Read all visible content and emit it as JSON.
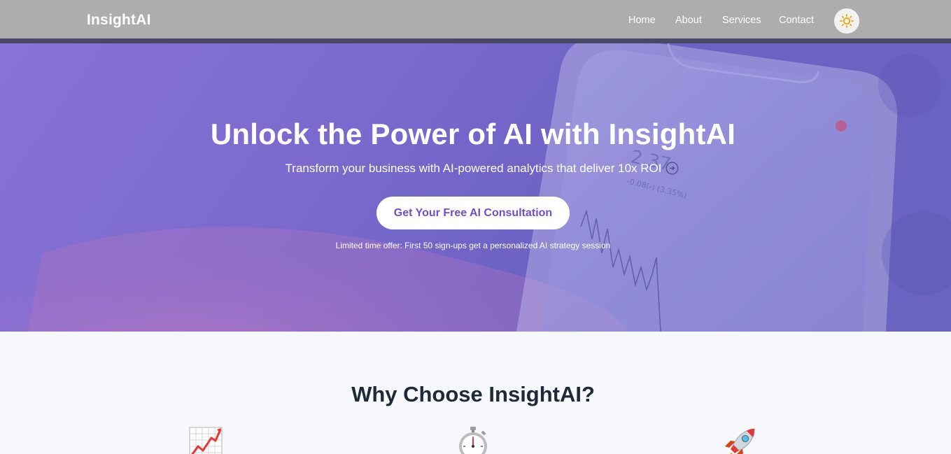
{
  "navbar": {
    "brand": "InsightAI",
    "links": [
      "Home",
      "About",
      "Services",
      "Contact"
    ],
    "theme_toggle_icon": "sun-icon"
  },
  "hero": {
    "title": "Unlock the Power of AI with InsightAI",
    "subtitle": "Transform your business with AI-powered analytics that deliver 10x ROI",
    "cta_label": "Get Your Free AI Consultation",
    "offer_text": "Limited time offer: First 50 sign-ups get a personalized AI strategy session"
  },
  "features": {
    "title": "Why Choose InsightAI?",
    "icons": [
      "chart-increasing-icon",
      "stopwatch-icon",
      "rocket-icon"
    ]
  },
  "colors": {
    "nav_bg": "#adadad",
    "hero_overlay": "#7b6acd",
    "cta_text": "#6f4fc9",
    "heading_text": "#1f2937"
  }
}
